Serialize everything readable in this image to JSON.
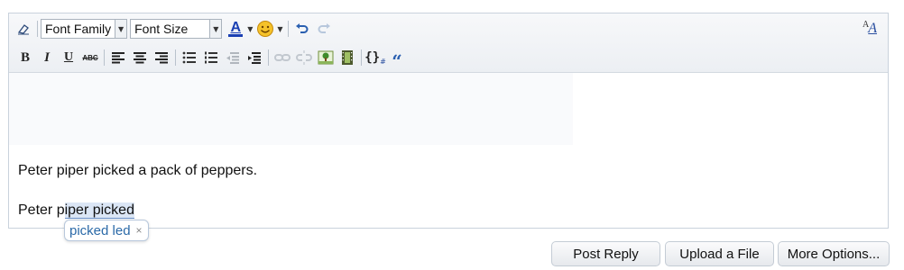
{
  "toolbar": {
    "font_family_label": "Font Family",
    "font_size_label": "Font Size",
    "row1_icons": [
      "eraser-icon",
      "font-color-icon",
      "smilie-icon",
      "undo-icon",
      "redo-icon"
    ],
    "row2_icons": [
      "bold-icon",
      "italic-icon",
      "underline-icon",
      "strikethrough-icon",
      "align-left-icon",
      "align-center-icon",
      "align-right-icon",
      "bullet-list-icon",
      "numbered-list-icon",
      "outdent-icon",
      "indent-icon",
      "link-icon",
      "unlink-icon",
      "image-icon",
      "media-icon",
      "code-icon",
      "quote-icon"
    ],
    "bold_glyph": "B",
    "italic_glyph": "I",
    "underline_glyph": "U",
    "strike_glyph": "ABC",
    "code_glyph": "{}",
    "quote_glyph": "“",
    "font_color_glyph": "A",
    "format_toggle_glyph": "A"
  },
  "editor": {
    "line1": "Peter piper picked a pack of peppers.",
    "line2_prefix": "Peter p",
    "line2_selected": "iper picked"
  },
  "autocomplete": {
    "suggestion": "picked led",
    "close": "×"
  },
  "buttons": {
    "post_reply": "Post Reply",
    "upload": "Upload a File",
    "more": "More Options..."
  },
  "colors": {
    "accent": "#2b6aa8",
    "selection": "#dbe6f5",
    "font_color_bar": "#1a3fb3"
  }
}
